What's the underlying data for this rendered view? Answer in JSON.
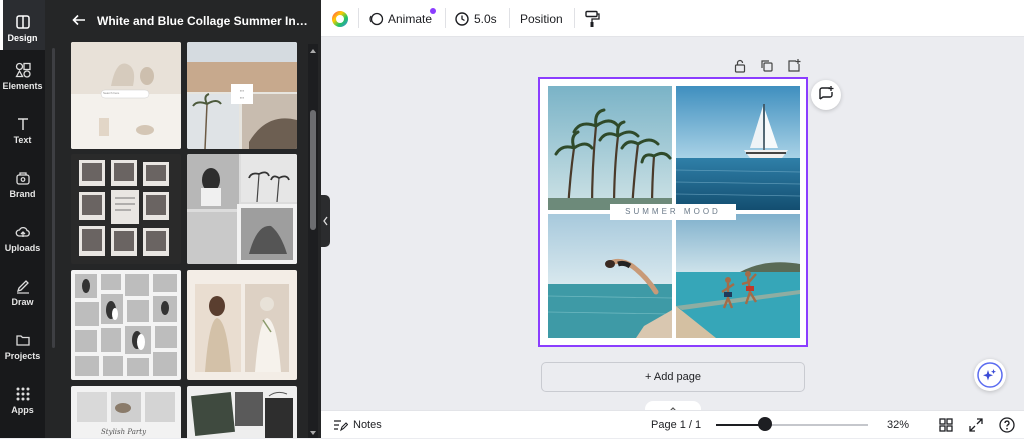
{
  "sidebar": {
    "items": [
      {
        "label": "Design"
      },
      {
        "label": "Elements"
      },
      {
        "label": "Text"
      },
      {
        "label": "Brand"
      },
      {
        "label": "Uploads"
      },
      {
        "label": "Draw"
      },
      {
        "label": "Projects"
      },
      {
        "label": "Apps"
      }
    ]
  },
  "panel": {
    "title": "White and Blue Collage Summer Instag...",
    "search_pill": "Search here",
    "template_script": "Stylish Party"
  },
  "toolbar": {
    "animate_label": "Animate",
    "duration_label": "5.0s",
    "position_label": "Position"
  },
  "canvas": {
    "overlay_text": "SUMMER MOOD",
    "add_page_label": "+ Add page"
  },
  "footer": {
    "notes_label": "Notes",
    "page_indicator": "Page 1 / 1",
    "zoom_label": "32%",
    "zoom_fraction": 0.32
  },
  "colors": {
    "accent": "#8b3dff",
    "rail_bg": "#18191b",
    "panel_bg": "#252627",
    "canvas_bg": "#ebecf0"
  }
}
